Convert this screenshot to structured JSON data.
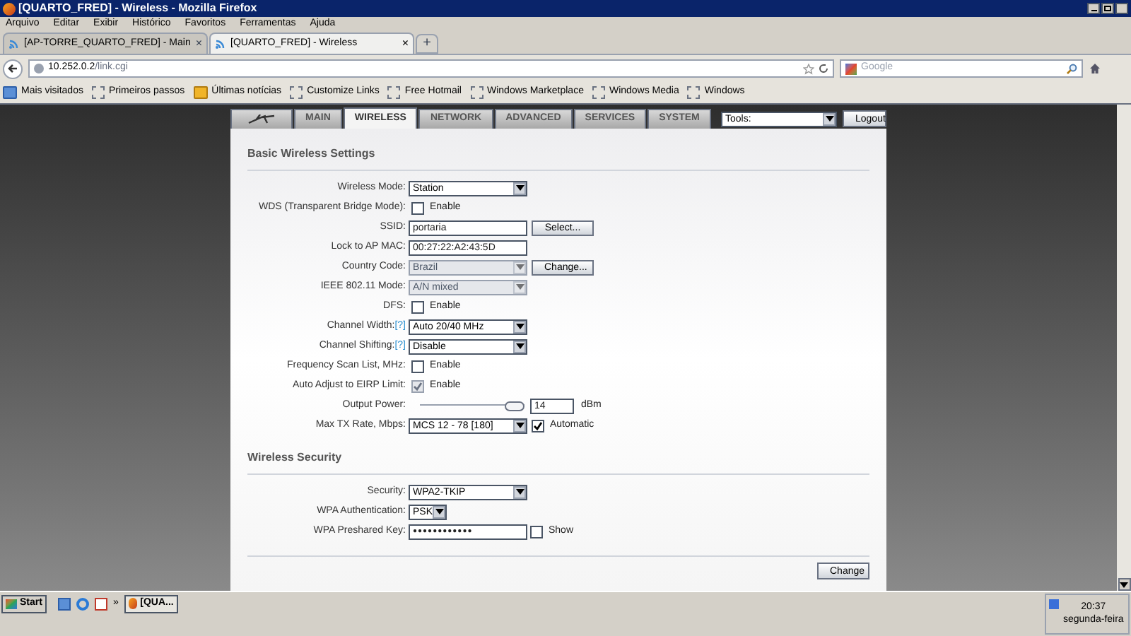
{
  "window": {
    "title": "[QUARTO_FRED] - Wireless - Mozilla Firefox"
  },
  "menu": [
    "Arquivo",
    "Editar",
    "Exibir",
    "Histórico",
    "Favoritos",
    "Ferramentas",
    "Ajuda"
  ],
  "browser_tabs": [
    {
      "label": "[AP-TORRE_QUARTO_FRED] - Main",
      "close": "×",
      "selected": false
    },
    {
      "label": "[QUARTO_FRED] - Wireless",
      "close": "×",
      "selected": true
    }
  ],
  "new_tab": "+",
  "address": {
    "host": "10.252.0.2",
    "path": "/link.cgi"
  },
  "search": {
    "placeholder": "Google"
  },
  "bookmarks": [
    {
      "label": "Mais visitados",
      "kind": "folder"
    },
    {
      "label": "Primeiros passos",
      "kind": "page"
    },
    {
      "label": "Últimas notícias",
      "kind": "feed"
    },
    {
      "label": "Customize Links",
      "kind": "page"
    },
    {
      "label": "Free Hotmail",
      "kind": "page"
    },
    {
      "label": "Windows Marketplace",
      "kind": "page"
    },
    {
      "label": "Windows Media",
      "kind": "page"
    },
    {
      "label": "Windows",
      "kind": "page"
    }
  ],
  "nav_tabs": [
    {
      "kind": "logo",
      "selected": false
    },
    {
      "label": "MAIN",
      "kind": "text",
      "selected": false
    },
    {
      "label": "WIRELESS",
      "kind": "text",
      "selected": true
    },
    {
      "label": "NETWORK",
      "kind": "text",
      "selected": false
    },
    {
      "label": "ADVANCED",
      "kind": "text",
      "selected": false
    },
    {
      "label": "SERVICES",
      "kind": "text",
      "selected": false
    },
    {
      "label": "SYSTEM",
      "kind": "text",
      "selected": false
    }
  ],
  "tools": {
    "value": "Tools:"
  },
  "logout": "Logout",
  "sections": [
    {
      "title": "Basic Wireless Settings",
      "rows": [
        {
          "label": "Wireless Mode:",
          "kind": "select",
          "value": "Station",
          "disabled": false
        },
        {
          "label": "WDS (Transparent Bridge Mode):",
          "kind": "checkbox",
          "text": "Enable",
          "checked": false,
          "disabled": false
        },
        {
          "label": "SSID:",
          "kind": "text",
          "value": "portaria",
          "button": "Select..."
        },
        {
          "label": "Lock to AP MAC:",
          "kind": "text",
          "value": "00:27:22:A2:43:5D"
        },
        {
          "label": "Country Code:",
          "kind": "select",
          "value": "Brazil",
          "disabled": true,
          "button": "Change..."
        },
        {
          "label": "IEEE 802.11 Mode:",
          "kind": "select",
          "value": "A/N mixed",
          "disabled": true
        },
        {
          "label": "DFS:",
          "kind": "checkbox",
          "text": "Enable",
          "checked": false,
          "disabled": false
        },
        {
          "label": "Channel Width:",
          "help": "[?]",
          "kind": "select",
          "value": "Auto 20/40 MHz",
          "disabled": false
        },
        {
          "label": "Channel Shifting:",
          "help": "[?]",
          "kind": "select",
          "value": "Disable",
          "disabled": false
        },
        {
          "label": "Frequency Scan List, MHz:",
          "kind": "checkbox",
          "text": "Enable",
          "checked": false,
          "disabled": false
        },
        {
          "label": "Auto Adjust to EIRP Limit:",
          "kind": "checkbox",
          "text": "Enable",
          "checked": true,
          "disabled": true
        },
        {
          "label": "Output Power:",
          "kind": "slider",
          "level": 1,
          "value": "14",
          "unit": "dBm"
        },
        {
          "label": "Max TX Rate, Mbps:",
          "kind": "select",
          "value": "MCS 12 - 78 [180]",
          "disabled": false,
          "check": {
            "text": "Automatic",
            "checked": true
          }
        }
      ]
    },
    {
      "title": "Wireless Security",
      "rows": [
        {
          "label": "Security:",
          "kind": "select",
          "value": "WPA2-TKIP",
          "disabled": false
        },
        {
          "label": "WPA Authentication:",
          "kind": "select",
          "value": "PSK",
          "disabled": false,
          "compact": true
        },
        {
          "label": "WPA Preshared Key:",
          "kind": "password",
          "value": "●●●●●●●●●●●●",
          "check": {
            "text": "Show",
            "checked": false
          }
        }
      ]
    }
  ],
  "change": "Change",
  "taskbar": {
    "start": "Start",
    "more": "»",
    "task": "[QUA...",
    "time": "20:37",
    "day": "segunda-feira"
  }
}
